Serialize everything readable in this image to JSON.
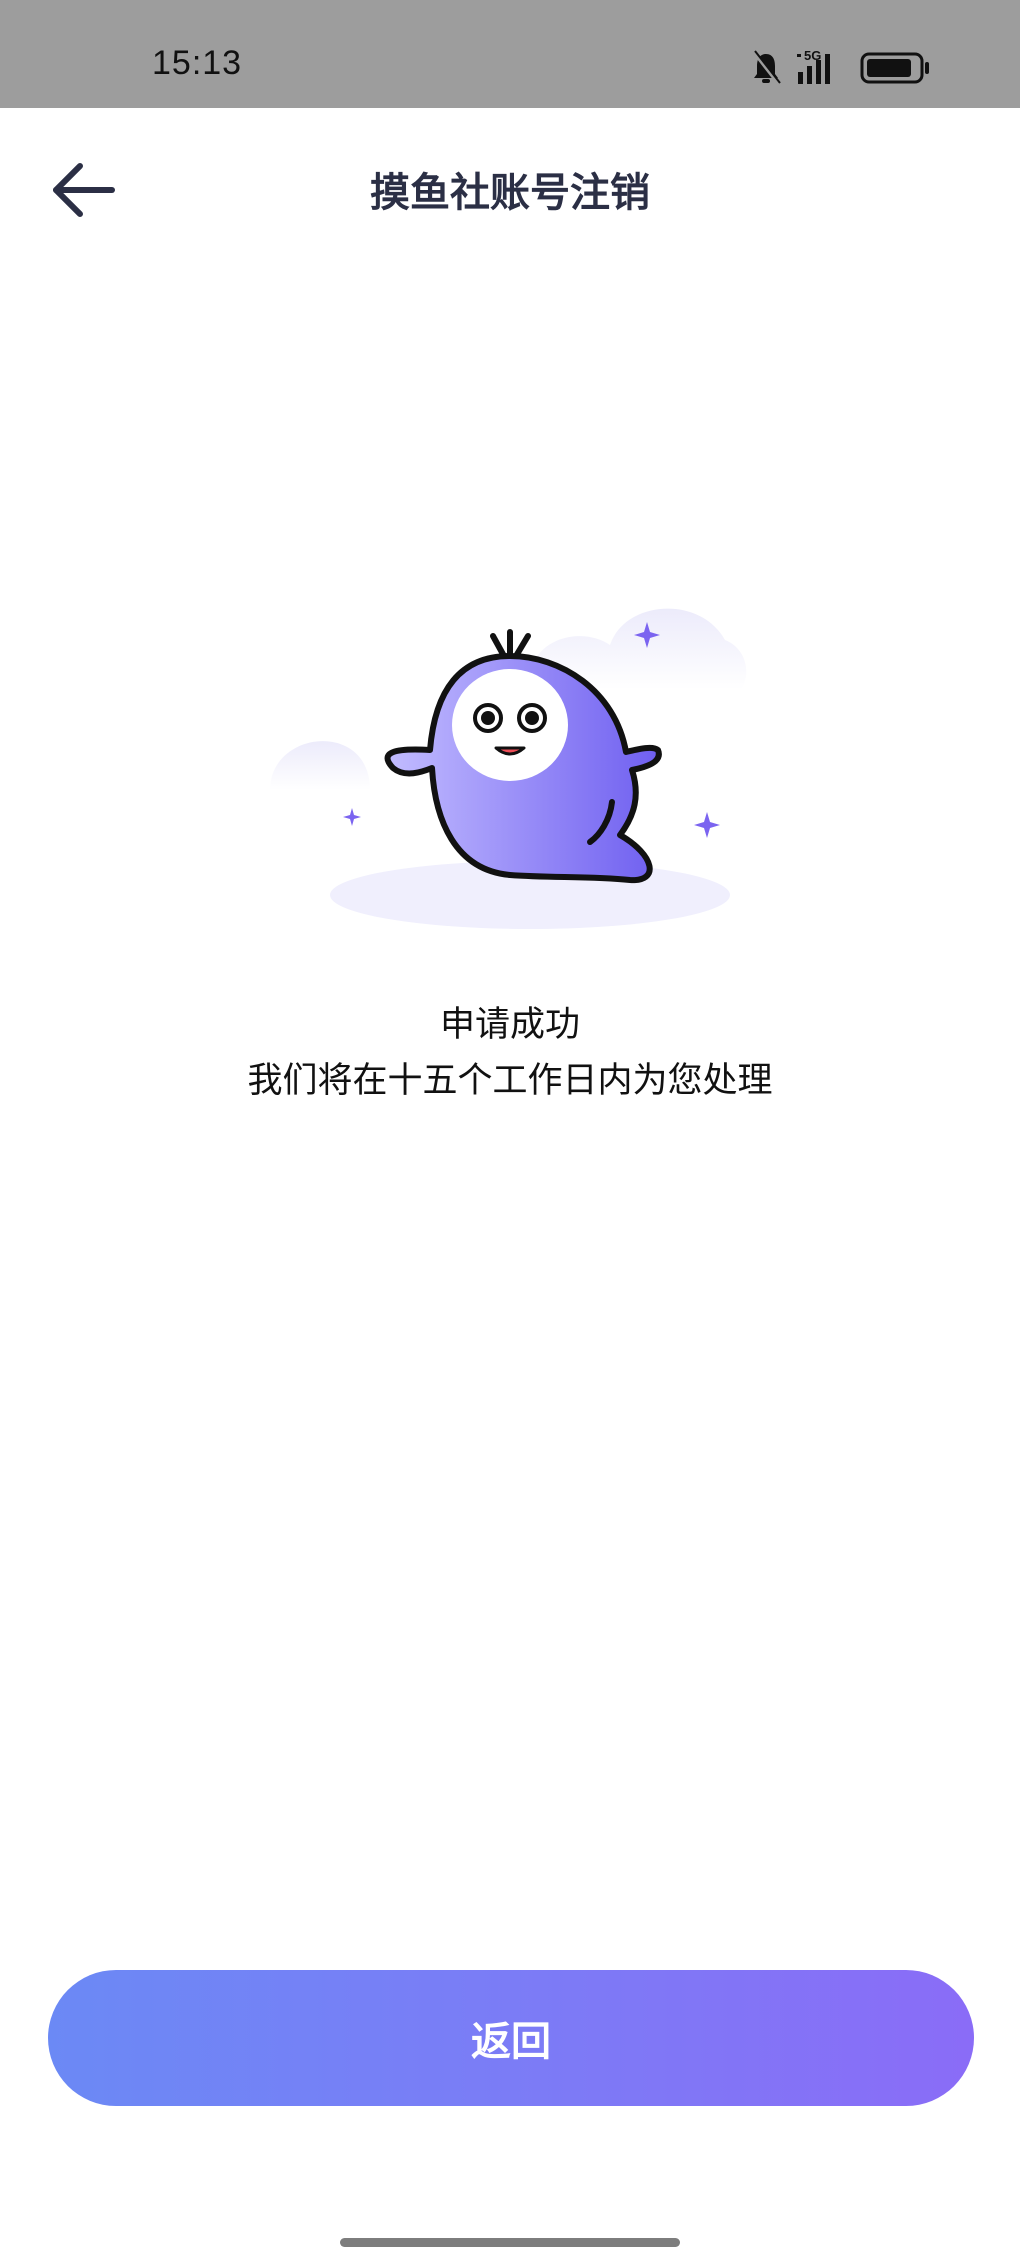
{
  "status_bar": {
    "time": "15:13",
    "network": "5G",
    "icons": [
      "bell-muted-icon",
      "signal-5g-icon",
      "battery-icon"
    ]
  },
  "nav": {
    "back_icon": "arrow-left-icon",
    "title": "摸鱼社账号注销"
  },
  "illustration": {
    "description_icon": "mascot-ghost-icon",
    "colors": {
      "primary": "#8a7cf6",
      "light": "#bdb6ff",
      "cloud": "#f0effd"
    }
  },
  "message": {
    "title": "申请成功",
    "subtitle": "我们将在十五个工作日内为您处理"
  },
  "button": {
    "label": "返回",
    "gradient_start": "#6b89f5",
    "gradient_end": "#8a6cf7"
  }
}
